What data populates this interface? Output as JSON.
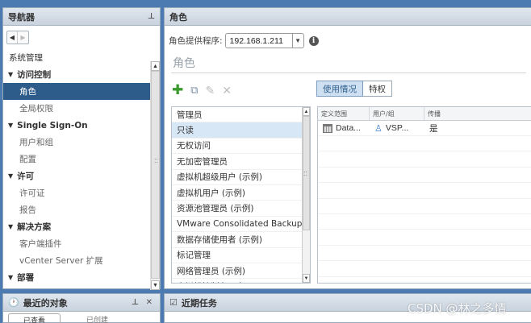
{
  "nav": {
    "title": "导航器",
    "pin": "⊥",
    "tree": [
      {
        "label": "系统管理",
        "kind": "section"
      },
      {
        "label": "访问控制",
        "kind": "group"
      },
      {
        "label": "角色",
        "kind": "sub",
        "selected": true
      },
      {
        "label": "全局权限",
        "kind": "sub"
      },
      {
        "label": "Single Sign-On",
        "kind": "group"
      },
      {
        "label": "用户和组",
        "kind": "sub"
      },
      {
        "label": "配置",
        "kind": "sub"
      },
      {
        "label": "许可",
        "kind": "group"
      },
      {
        "label": "许可证",
        "kind": "sub"
      },
      {
        "label": "报告",
        "kind": "sub"
      },
      {
        "label": "解决方案",
        "kind": "group"
      },
      {
        "label": "客户端插件",
        "kind": "sub"
      },
      {
        "label": "vCenter Server 扩展",
        "kind": "sub"
      },
      {
        "label": "部署",
        "kind": "group"
      }
    ]
  },
  "main": {
    "title": "角色",
    "provider_label": "角色提供程序:",
    "provider_value": "192.168.1.211",
    "heading": "角色",
    "tabs": [
      "使用情况",
      "特权"
    ],
    "roles": [
      "管理员",
      "只读",
      "无权访问",
      "无加密管理员",
      "虚拟机超级用户 (示例)",
      "虚拟机用户 (示例)",
      "资源池管理员 (示例)",
      "VMware Consolidated Backup...",
      "数据存储使用者 (示例)",
      "标记管理",
      "网络管理员 (示例)",
      "虚拟机控制台用户"
    ],
    "selected_role_index": 1,
    "usage": {
      "columns": [
        "定义范围",
        "用户/组",
        "传播"
      ],
      "rows": [
        {
          "scope": "Data...",
          "user": "VSP...",
          "propagate": "是"
        }
      ]
    }
  },
  "recent": {
    "title": "最近的对象",
    "controls": "⊥ ✕",
    "tabs": [
      "已查看",
      "已创建"
    ]
  },
  "tasks": {
    "title": "近期任务"
  },
  "watermark": "CSDN @林之多情"
}
